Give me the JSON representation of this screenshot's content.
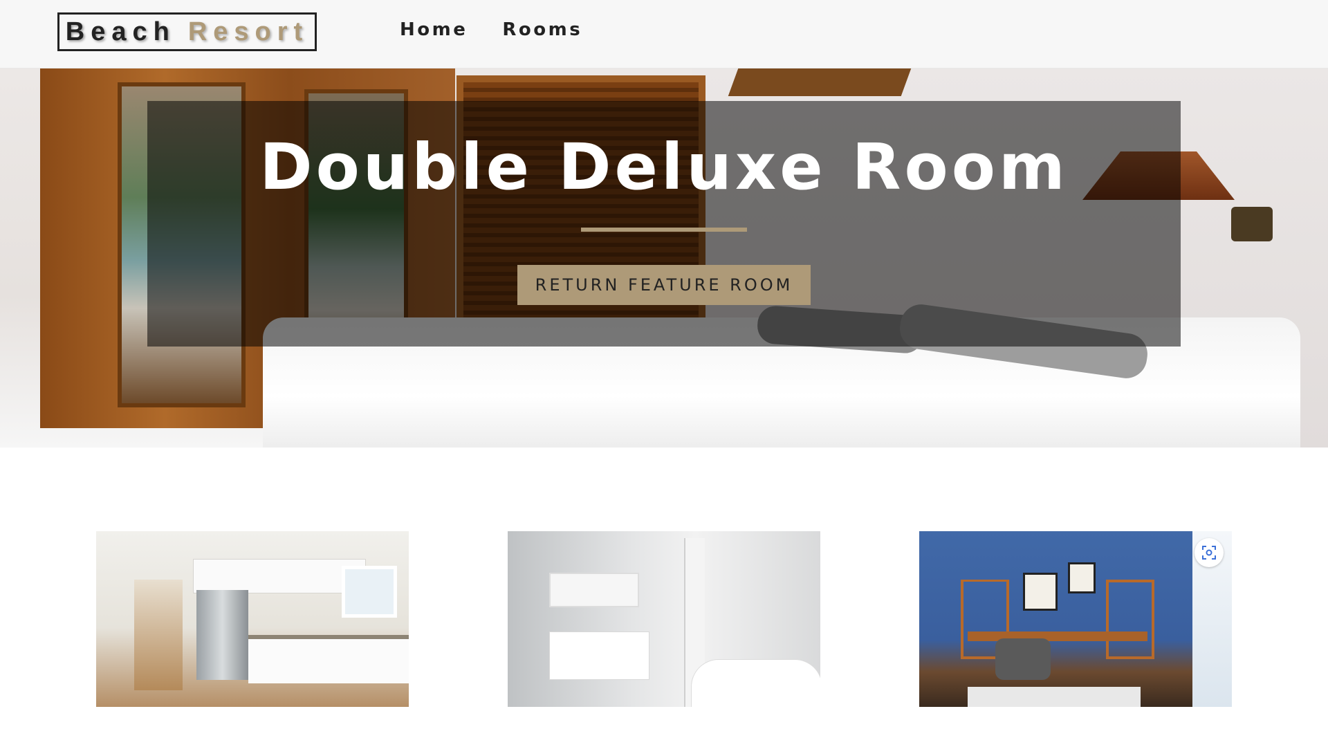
{
  "brand": {
    "word1": "Beach",
    "word2": "Resort"
  },
  "nav": {
    "items": [
      {
        "label": "Home"
      },
      {
        "label": "Rooms"
      }
    ]
  },
  "hero": {
    "title": "Double Deluxe Room",
    "button_label": "RETURN FEATURE ROOM",
    "background_icon": "bedroom-photo"
  },
  "gallery": {
    "images": [
      {
        "icon": "kitchen-photo"
      },
      {
        "icon": "bathroom-photo"
      },
      {
        "icon": "office-photo"
      }
    ],
    "lens_icon": "visual-search-icon"
  },
  "colors": {
    "accent": "#ae9a78",
    "nav_bg": "#f7f7f7",
    "overlay": "rgba(0,0,0,0.52)"
  }
}
